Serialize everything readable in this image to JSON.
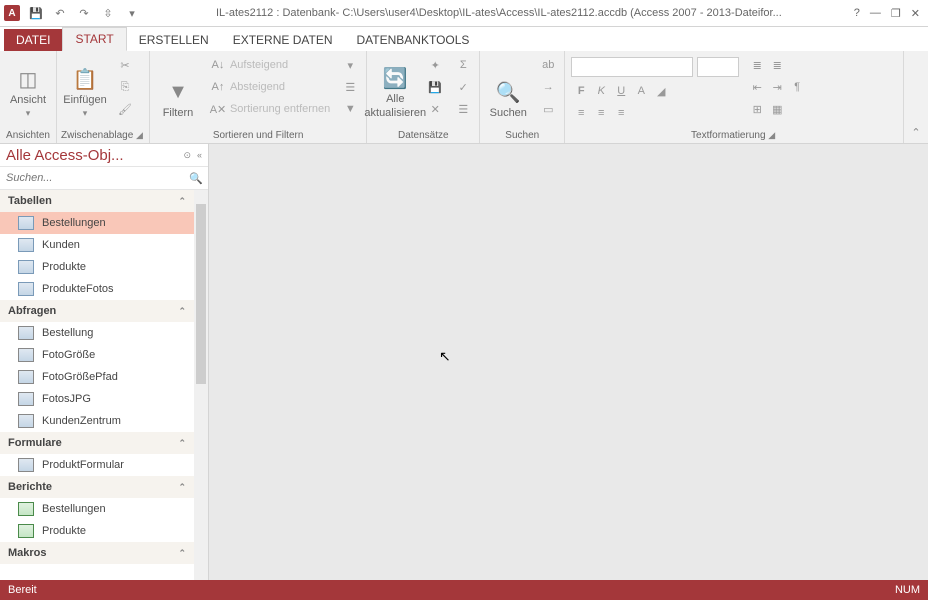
{
  "titlebar": {
    "app_icon": "A",
    "title": "IL-ates2112 : Datenbank- C:\\Users\\user4\\Desktop\\IL-ates\\Access\\IL-ates2112.accdb (Access 2007 - 2013-Dateifor..."
  },
  "tabs": {
    "file": "DATEI",
    "start": "START",
    "erstellen": "ERSTELLEN",
    "externe": "EXTERNE DATEN",
    "tools": "DATENBANKTOOLS"
  },
  "ribbon": {
    "ansichten": {
      "label": "Ansichten",
      "ansicht": "Ansicht"
    },
    "zwischen": {
      "label": "Zwischenablage",
      "einfuegen": "Einfügen"
    },
    "sortfilter": {
      "label": "Sortieren und Filtern",
      "filtern": "Filtern",
      "auf": "Aufsteigend",
      "ab": "Absteigend",
      "ent": "Sortierung entfernen"
    },
    "datensaetze": {
      "label": "Datensätze",
      "alle": "Alle",
      "akt": "aktualisieren"
    },
    "suchen": {
      "label": "Suchen",
      "suchen": "Suchen"
    },
    "textfmt": {
      "label": "Textformatierung"
    }
  },
  "nav": {
    "title": "Alle Access-Obj...",
    "search_placeholder": "Suchen...",
    "cats": {
      "tabellen": "Tabellen",
      "abfragen": "Abfragen",
      "formulare": "Formulare",
      "berichte": "Berichte",
      "makros": "Makros"
    },
    "tabellen": [
      "Bestellungen",
      "Kunden",
      "Produkte",
      "ProdukteFotos"
    ],
    "abfragen": [
      "Bestellung",
      "FotoGröße",
      "FotoGrößePfad",
      "FotosJPG",
      "KundenZentrum"
    ],
    "formulare": [
      "ProduktFormular"
    ],
    "berichte": [
      "Bestellungen",
      "Produkte"
    ]
  },
  "status": {
    "ready": "Bereit",
    "num": "NUM"
  }
}
